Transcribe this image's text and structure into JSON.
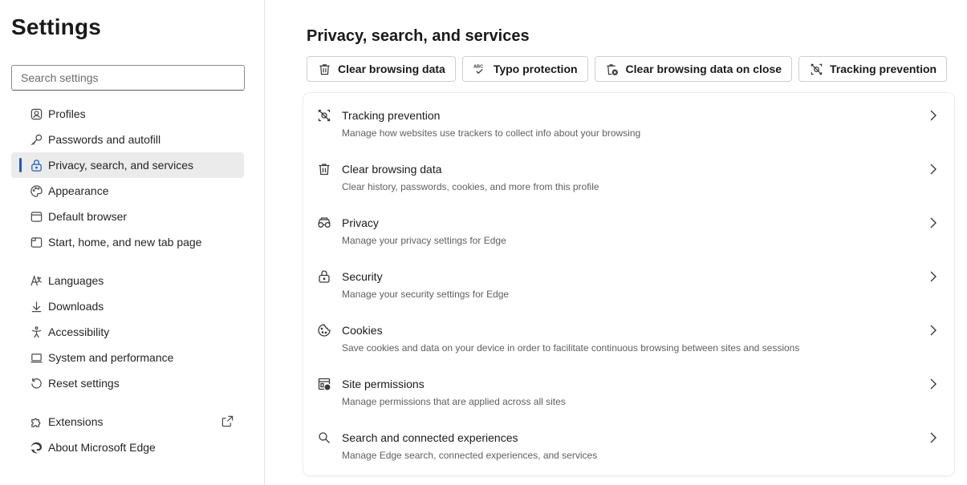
{
  "sidebar": {
    "title": "Settings",
    "search_placeholder": "Search settings",
    "items": [
      {
        "label": "Profiles",
        "icon": "profile-icon"
      },
      {
        "label": "Passwords and autofill",
        "icon": "key-icon"
      },
      {
        "label": "Privacy, search, and services",
        "icon": "lock-icon",
        "active": true
      },
      {
        "label": "Appearance",
        "icon": "palette-icon"
      },
      {
        "label": "Default browser",
        "icon": "browser-icon"
      },
      {
        "label": "Start, home, and new tab page",
        "icon": "home-tab-icon"
      },
      {
        "label": "Languages",
        "icon": "languages-icon"
      },
      {
        "label": "Downloads",
        "icon": "download-icon"
      },
      {
        "label": "Accessibility",
        "icon": "accessibility-icon"
      },
      {
        "label": "System and performance",
        "icon": "laptop-icon"
      },
      {
        "label": "Reset settings",
        "icon": "reset-icon"
      },
      {
        "label": "Extensions",
        "icon": "puzzle-icon"
      },
      {
        "label": "About Microsoft Edge",
        "icon": "edge-logo-icon"
      }
    ]
  },
  "main": {
    "title": "Privacy, search, and services",
    "chips": [
      {
        "label": "Clear browsing data",
        "icon": "trash-icon"
      },
      {
        "label": "Typo protection",
        "icon": "abc-check-icon"
      },
      {
        "label": "Clear browsing data on close",
        "icon": "trash-clear-icon"
      },
      {
        "label": "Tracking prevention",
        "icon": "tracking-icon"
      }
    ],
    "rows": [
      {
        "title": "Tracking prevention",
        "desc": "Manage how websites use trackers to collect info about your browsing",
        "icon": "tracking-icon"
      },
      {
        "title": "Clear browsing data",
        "desc": "Clear history, passwords, cookies, and more from this profile",
        "icon": "trash-icon"
      },
      {
        "title": "Privacy",
        "desc": "Manage your privacy settings for Edge",
        "icon": "glasses-icon"
      },
      {
        "title": "Security",
        "desc": "Manage your security settings for Edge",
        "icon": "lock-icon"
      },
      {
        "title": "Cookies",
        "desc": "Save cookies and data on your device in order to facilitate continuous browsing between sites and sessions",
        "icon": "cookie-icon"
      },
      {
        "title": "Site permissions",
        "desc": "Manage permissions that are applied across all sites",
        "icon": "site-permissions-icon"
      },
      {
        "title": "Search and connected experiences",
        "desc": "Manage Edge search, connected experiences, and services",
        "icon": "search-icon"
      }
    ]
  },
  "colors": {
    "accent": "#1c5bbd",
    "active_bg": "#ebebeb"
  }
}
